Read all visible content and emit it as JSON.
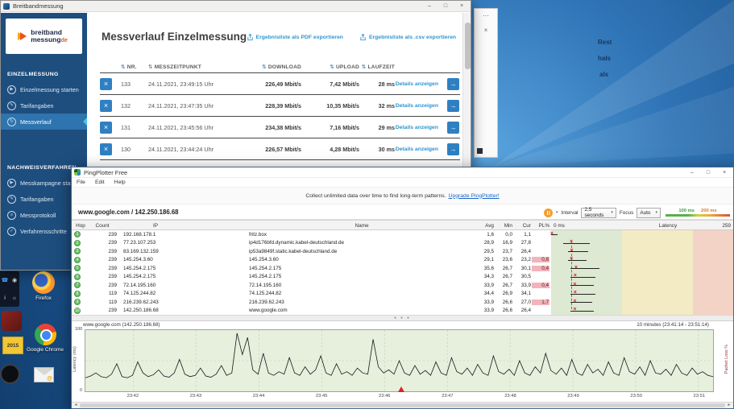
{
  "desktop": {
    "peek_text": [
      "Rest",
      "hals",
      "als"
    ],
    "icons": {
      "firefox_label": "Firefox",
      "chrome_label": "Google Chrome",
      "note_text": "2015"
    }
  },
  "bbm_window": {
    "title": "Breitbandmessung",
    "window_controls": {
      "minimize": "–",
      "maximize": "□",
      "close": "×"
    },
    "logo": {
      "line1": "breitband",
      "line2": "messung",
      "tld": "de"
    },
    "sidebar": {
      "sections": [
        {
          "header": "EINZELMESSUNG",
          "items": [
            {
              "label": "Einzelmessung starten",
              "icon": "play-icon",
              "selected": false
            },
            {
              "label": "Tarifangaben",
              "icon": "tariff-icon",
              "selected": false
            },
            {
              "label": "Messverlauf",
              "icon": "history-icon",
              "selected": true
            }
          ]
        },
        {
          "header": "NACHWEISVERFAHREN",
          "items": [
            {
              "label": "Messkampagne starten",
              "icon": "campaign-icon",
              "selected": false
            },
            {
              "label": "Tarifangaben",
              "icon": "tariff-icon",
              "selected": false
            },
            {
              "label": "Messprotokoll",
              "icon": "protocol-icon",
              "selected": false
            },
            {
              "label": "Verfahrensschritte",
              "icon": "steps-icon",
              "selected": false
            }
          ]
        }
      ]
    },
    "main": {
      "heading": "Messverlauf Einzelmessung",
      "export_pdf": "Ergebnisliste als PDF exportieren",
      "export_csv": "Ergebnisliste als .csv exportieren",
      "columns": [
        "NR.",
        "MESSZEITPUNKT",
        "DOWNLOAD",
        "UPLOAD",
        "LAUFZEIT"
      ],
      "details_label": "Details anzeigen",
      "rows": [
        {
          "nr": "133",
          "zeit": "24.11.2021, 23:49:15 Uhr",
          "download": "226,49 Mbit/s",
          "upload": "7,42 Mbit/s",
          "laufzeit": "28 ms"
        },
        {
          "nr": "132",
          "zeit": "24.11.2021, 23:47:35 Uhr",
          "download": "228,39 Mbit/s",
          "upload": "10,35 Mbit/s",
          "laufzeit": "32 ms"
        },
        {
          "nr": "131",
          "zeit": "24.11.2021, 23:45:56 Uhr",
          "download": "234,38 Mbit/s",
          "upload": "7,16 Mbit/s",
          "laufzeit": "29 ms"
        },
        {
          "nr": "130",
          "zeit": "24.11.2021, 23:44:24 Uhr",
          "download": "226,57 Mbit/s",
          "upload": "4,28 Mbit/s",
          "laufzeit": "30 ms"
        }
      ]
    }
  },
  "pp_window": {
    "title": "PingPlotter Free",
    "window_controls": {
      "minimize": "–",
      "maximize": "□",
      "close": "×"
    },
    "menu": [
      "File",
      "Edit",
      "Help"
    ],
    "banner": {
      "text": "Collect unlimited data over time to find long-term patterns.",
      "link": "Upgrade PingPlotter!"
    },
    "target": "www.google.com / 142.250.186.68",
    "controls": {
      "interval_label": "Interval",
      "interval_value": "2,5 seconds",
      "focus_label": "Focus",
      "focus_value": "Auto"
    },
    "legend": {
      "green": "100 ms",
      "orange": "200 ms"
    },
    "table": {
      "columns": [
        "Hop",
        "Count",
        "IP",
        "Name",
        "Avg",
        "Min",
        "Cur",
        "PL%"
      ],
      "scale": {
        "zero_label": "0 ms",
        "axis_label": "Latency",
        "max_label": "259",
        "max_ms": 259
      },
      "hops": [
        {
          "hop": "1",
          "count": "239",
          "ip": "192.168.178.1",
          "name": "fritz.box",
          "avg": "1,6",
          "min": "0,0",
          "cur": "1,1",
          "pl": "",
          "g": {
            "min": 0,
            "max": 9,
            "avg": 1.6
          }
        },
        {
          "hop": "2",
          "count": "239",
          "ip": "77.23.107.253",
          "name": "ip4d176bfd.dynamic.kabel-deutschland.de",
          "avg": "28,9",
          "min": "16,9",
          "cur": "27,8",
          "pl": "",
          "g": {
            "min": 17,
            "max": 55,
            "avg": 28.9
          }
        },
        {
          "hop": "3",
          "count": "239",
          "ip": "83.169.132.159",
          "name": "ip53a9849f.static.kabel-deutschland.de",
          "avg": "29,5",
          "min": "23,7",
          "cur": "26,4",
          "pl": "",
          "g": {
            "min": 24,
            "max": 52,
            "avg": 29.5
          }
        },
        {
          "hop": "4",
          "count": "239",
          "ip": "145.254.3.60",
          "name": "145.254.3.60",
          "avg": "29,1",
          "min": "23,6",
          "cur": "23,2",
          "pl": "0,8",
          "g": {
            "min": 24,
            "max": 50,
            "avg": 29.1
          }
        },
        {
          "hop": "5",
          "count": "239",
          "ip": "145.254.2.175",
          "name": "145.254.2.175",
          "avg": "35,6",
          "min": "26,7",
          "cur": "30,1",
          "pl": "0,4",
          "g": {
            "min": 27,
            "max": 68,
            "avg": 35.6
          }
        },
        {
          "hop": "6",
          "count": "239",
          "ip": "145.254.2.175",
          "name": "145.254.2.175",
          "avg": "34,3",
          "min": "26,7",
          "cur": "30,5",
          "pl": "",
          "g": {
            "min": 27,
            "max": 62,
            "avg": 34.3
          }
        },
        {
          "hop": "7",
          "count": "239",
          "ip": "72.14.195.160",
          "name": "72.14.195.160",
          "avg": "33,9",
          "min": "26,7",
          "cur": "33,9",
          "pl": "0,4",
          "g": {
            "min": 27,
            "max": 60,
            "avg": 33.9
          }
        },
        {
          "hop": "8",
          "count": "119",
          "ip": "74.125.244.82",
          "name": "74.125.244.82",
          "avg": "34,4",
          "min": "26,9",
          "cur": "34,1",
          "pl": "",
          "g": {
            "min": 27,
            "max": 63,
            "avg": 34.4
          }
        },
        {
          "hop": "9",
          "count": "119",
          "ip": "216.239.62.243",
          "name": "216.239.62.243",
          "avg": "33,9",
          "min": "26,6",
          "cur": "27,0",
          "pl": "1,7",
          "g": {
            "min": 27,
            "max": 58,
            "avg": 33.9
          }
        },
        {
          "hop": "10",
          "count": "239",
          "ip": "142.250.186.68",
          "name": "www.google.com",
          "avg": "33,9",
          "min": "26,6",
          "cur": "26,4",
          "pl": "",
          "g": {
            "min": 27,
            "max": 60,
            "avg": 33.9
          }
        }
      ]
    },
    "timeline": {
      "target_label": "www.google.com (142.250.186.68)",
      "range_label": "10 minutes (23:41:14 - 23:51:14)",
      "y_axis_label": "Latency (ms)",
      "right_axis_label": "Packet Loss %",
      "y_max": "100",
      "y_min": "0",
      "xticks": [
        "23:42",
        "23:43",
        "23:44",
        "23:45",
        "23:46",
        "23:47",
        "23:48",
        "23:49",
        "23:50",
        "23:51"
      ],
      "loss_marker_frac": 0.503,
      "values": [
        22,
        25,
        30,
        24,
        22,
        28,
        45,
        24,
        22,
        26,
        48,
        30,
        24,
        27,
        35,
        25,
        23,
        30,
        52,
        28,
        24,
        26,
        38,
        25,
        23,
        28,
        42,
        26,
        30,
        95,
        60,
        88,
        35,
        28,
        62,
        30,
        26,
        32,
        28,
        55,
        30,
        26,
        40,
        28,
        35,
        58,
        30,
        26,
        45,
        28,
        32,
        26,
        38,
        30,
        28,
        85,
        40,
        30,
        35,
        28,
        50,
        30,
        26,
        42,
        28,
        34,
        26,
        48,
        30,
        26,
        55,
        32,
        28,
        38,
        26,
        44,
        30,
        26,
        58,
        32,
        28,
        36,
        26,
        50,
        30,
        26,
        40,
        30,
        62,
        34,
        28,
        38,
        26,
        52,
        30,
        26,
        44,
        30,
        36,
        26,
        48,
        30,
        26,
        55,
        32,
        28,
        40,
        26,
        50,
        30,
        28,
        36,
        26,
        44,
        30,
        26,
        38,
        28,
        32,
        26,
        24
      ]
    }
  }
}
